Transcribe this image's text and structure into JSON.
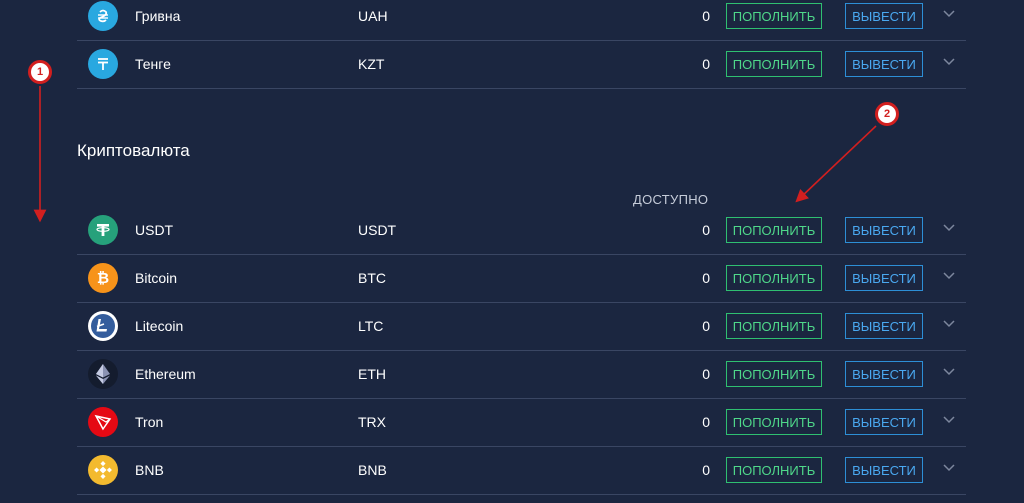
{
  "fiat_rows": [
    {
      "name": "Гривна",
      "code": "UAH",
      "amount": "0",
      "icon": "hryvnia-icon",
      "color": "#29a8e0"
    },
    {
      "name": "Тенге",
      "code": "KZT",
      "amount": "0",
      "icon": "tenge-icon",
      "color": "#29a8e0"
    }
  ],
  "crypto_section": {
    "title": "Криптовалюта",
    "available_header": "ДОСТУПНО"
  },
  "crypto_rows": [
    {
      "name": "USDT",
      "code": "USDT",
      "amount": "0",
      "icon": "tether-icon",
      "color": "#26a17b"
    },
    {
      "name": "Bitcoin",
      "code": "BTC",
      "amount": "0",
      "icon": "bitcoin-icon",
      "color": "#f7931a"
    },
    {
      "name": "Litecoin",
      "code": "LTC",
      "amount": "0",
      "icon": "litecoin-icon",
      "color": "#ffffff"
    },
    {
      "name": "Ethereum",
      "code": "ETH",
      "amount": "0",
      "icon": "ethereum-icon",
      "color": "#141c2e"
    },
    {
      "name": "Tron",
      "code": "TRX",
      "amount": "0",
      "icon": "tron-icon",
      "color": "#e50914"
    },
    {
      "name": "BNB",
      "code": "BNB",
      "amount": "0",
      "icon": "bnb-icon",
      "color": "#f3ba2f"
    }
  ],
  "buttons": {
    "deposit_label": "ПОПОЛНИТЬ",
    "withdraw_label": "ВЫВЕСТИ"
  },
  "annotations": {
    "marker_1": "1",
    "marker_2": "2",
    "color": "#d21f1f"
  },
  "colors": {
    "background": "#1b2640",
    "deposit": "#2fbf71",
    "withdraw": "#2d8ed6"
  }
}
